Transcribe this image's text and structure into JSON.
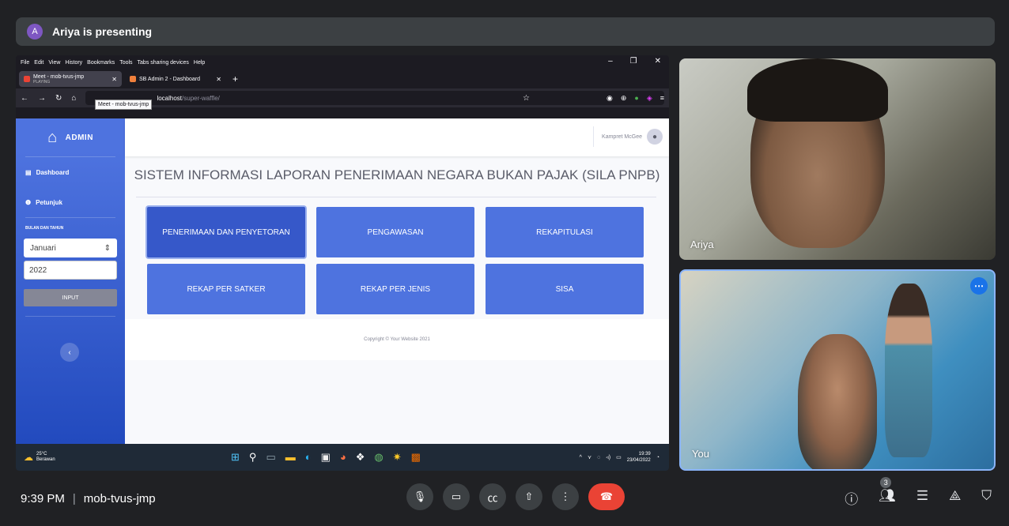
{
  "presenting": {
    "avatar_letter": "A",
    "text": "Ariya is presenting"
  },
  "browser": {
    "menu": [
      "File",
      "Edit",
      "View",
      "History",
      "Bookmarks",
      "Tools",
      "Tabs sharing devices",
      "Help"
    ],
    "tabs": [
      {
        "label": "Meet - mob-tvus-jmp",
        "sub": "PLAYING"
      },
      {
        "label": "SB Admin 2 - Dashboard"
      }
    ],
    "tooltip": "Meet - mob-tvus-jmp",
    "url_host": "localhost",
    "url_path": "/super-waffle/"
  },
  "app": {
    "brand": "ADMIN",
    "nav": [
      {
        "label": "Dashboard"
      },
      {
        "label": "Petunjuk"
      }
    ],
    "period_heading": "BULAN DAN TAHUN",
    "month_value": "Januari",
    "year_value": "2022",
    "input_button": "INPUT",
    "user_name": "Kampret McGee",
    "page_title": "SISTEM INFORMASI LAPORAN PENERIMAAN NEGARA BUKAN PAJAK (SILA PNPB)",
    "menu_buttons": [
      "PENERIMAAN DAN PENYETORAN",
      "PENGAWASAN",
      "REKAPITULASI",
      "REKAP PER SATKER",
      "REKAP PER JENIS",
      "SISA"
    ],
    "footer": "Copyright © Your Website 2021"
  },
  "taskbar": {
    "temperature": "25°C",
    "weather": "Berawan",
    "time": "19:39",
    "date": "23/04/2022"
  },
  "tiles": {
    "ariya_label": "Ariya",
    "you_label": "You"
  },
  "meeting": {
    "time": "9:39 PM",
    "code": "mob-tvus-jmp",
    "participants_count": "3"
  }
}
